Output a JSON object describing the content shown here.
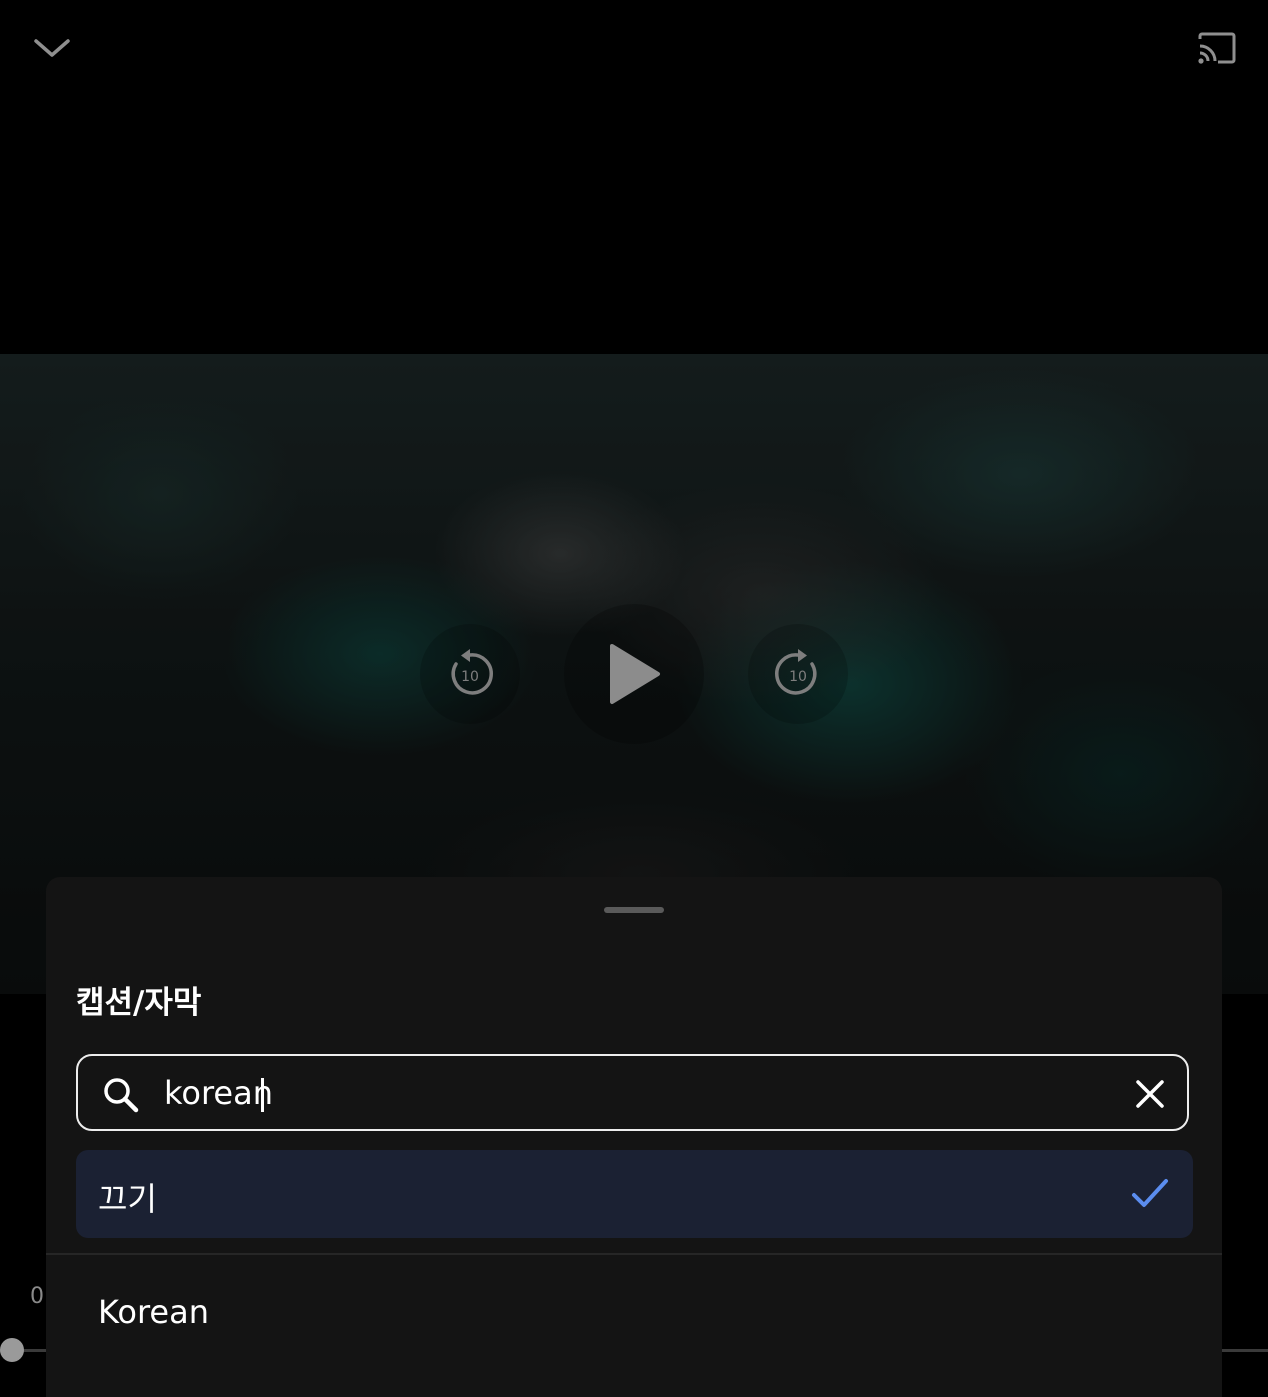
{
  "player": {
    "current_time": "0",
    "seek_fraction": 0.0
  },
  "controls": {
    "rewind_seconds": "10",
    "forward_seconds": "10"
  },
  "caption_sheet": {
    "title": "캡션/자막",
    "search": {
      "value": "korean",
      "placeholder": ""
    },
    "options": [
      {
        "label": "끄기",
        "selected": true
      },
      {
        "label": "Korean",
        "selected": false
      }
    ]
  },
  "colors": {
    "background": "#000000",
    "sheet": "#141414",
    "selected_row": "#1b2133",
    "check_accent": "#5b8def"
  },
  "icons": [
    "chevron-down-icon",
    "cast-icon",
    "rewind-10-icon",
    "play-icon",
    "forward-10-icon",
    "search-icon",
    "close-icon",
    "check-icon"
  ]
}
